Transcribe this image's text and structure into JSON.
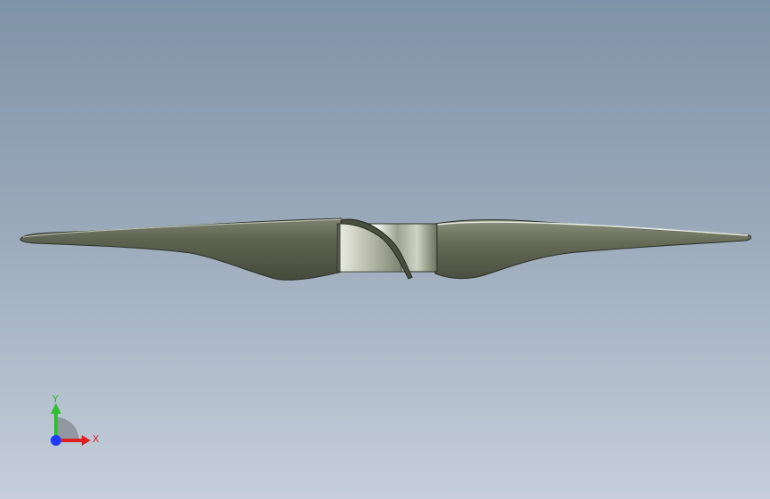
{
  "viewport": {
    "model_name": "propeller"
  },
  "triad": {
    "x_label": "X",
    "y_label": "Y"
  },
  "colors": {
    "background_top": "#7f93a8",
    "background_bottom": "#c6cfdb",
    "x_axis": "#e02020",
    "y_axis": "#2fbf2f",
    "z_axis": "#1e3bff"
  },
  "icons": {
    "triad": "view-orientation-triad-icon"
  }
}
